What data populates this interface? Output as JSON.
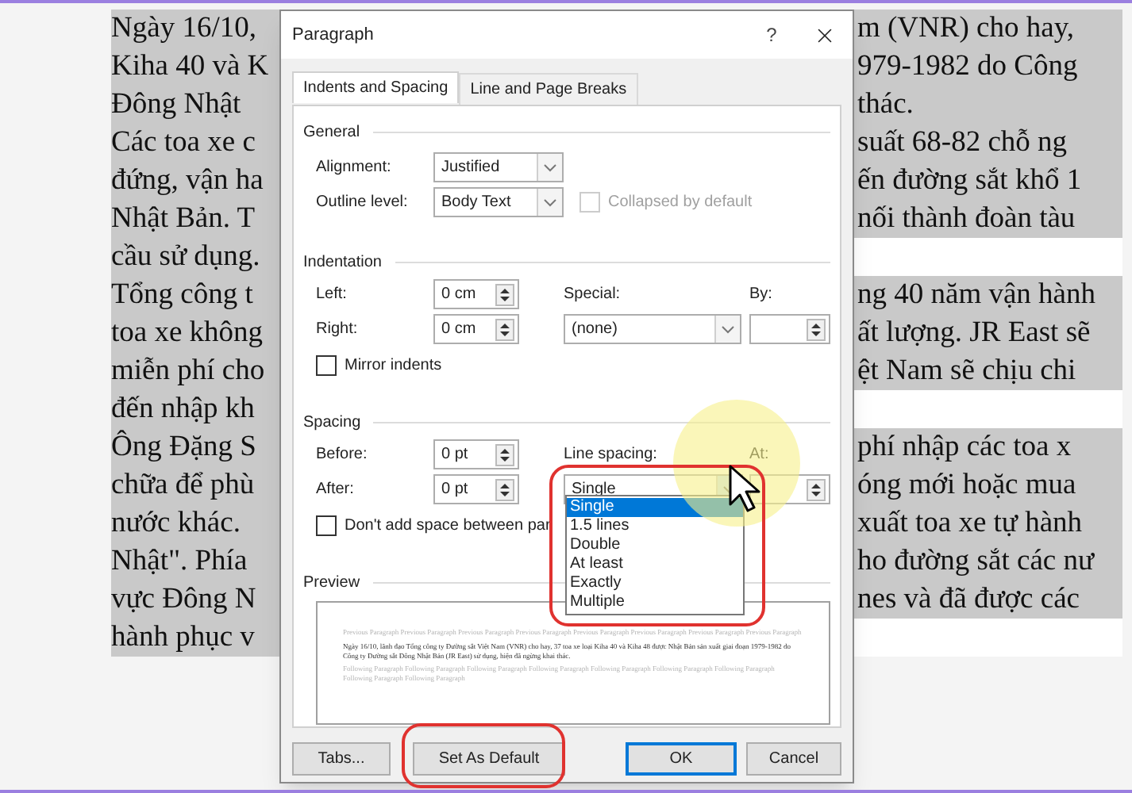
{
  "document": {
    "lines": [
      {
        "left": "Ngày 16/10,",
        "right": "m (VNR) cho hay,"
      },
      {
        "left": "Kiha 40 và K",
        "right": "979-1982 do Công"
      },
      {
        "left": "Đông Nhật",
        "right": "thác."
      },
      {
        "left": "Các toa xe c",
        "right": "suất 68-82 chỗ ng"
      },
      {
        "left": "đứng, vận ha",
        "right": "ến đường sắt khổ 1"
      },
      {
        "left": "Nhật Bản. T",
        "right": "nối thành đoàn tàu"
      },
      {
        "left": "cầu sử dụng."
      },
      {
        "left": "Tổng công t",
        "right": "ng 40 năm vận hành"
      },
      {
        "left": "toa xe không",
        "right": "ất lượng. JR East sẽ"
      },
      {
        "left": "miễn phí cho",
        "right": "ệt Nam sẽ chịu chi"
      },
      {
        "left": "đến nhập kh"
      },
      {
        "left": "Ông Đặng S",
        "right": "phí nhập các toa x"
      },
      {
        "left": "chữa để phù",
        "right": "óng mới hoặc mua"
      },
      {
        "left": "nước khác.",
        "right": "xuất toa xe tự hành"
      },
      {
        "left": "Nhật\". Phía",
        "right": "ho đường sắt các nư"
      },
      {
        "left": "vực Đông N",
        "right": "nes và đã được các"
      },
      {
        "left": "hành phục v"
      }
    ]
  },
  "dialog": {
    "title": "Paragraph",
    "help": "?",
    "tabs": [
      {
        "label": "Indents and Spacing",
        "selected": true
      },
      {
        "label": "Line and Page Breaks",
        "selected": false
      }
    ],
    "general": {
      "heading": "General",
      "alignment": {
        "label": "Alignment:",
        "value": "Justified"
      },
      "outline_level": {
        "label": "Outline level:",
        "value": "Body Text"
      },
      "collapsed": {
        "label": "Collapsed by default",
        "checked": false,
        "disabled": true
      }
    },
    "indentation": {
      "heading": "Indentation",
      "left": {
        "label": "Left:",
        "value": "0 cm"
      },
      "right": {
        "label": "Right:",
        "value": "0 cm"
      },
      "special": {
        "label": "Special:",
        "value": "(none)"
      },
      "by": {
        "label": "By:"
      },
      "mirror": {
        "label": "Mirror indents",
        "checked": false,
        "disabled": false
      }
    },
    "spacing": {
      "heading": "Spacing",
      "before": {
        "label": "Before:",
        "value": "0 pt"
      },
      "after": {
        "label": "After:",
        "value": "0 pt"
      },
      "line_spacing": {
        "label": "Line spacing:",
        "value": "Single",
        "expanded": true,
        "options": [
          {
            "label": "Single",
            "selected": true
          },
          {
            "label": "1.5 lines",
            "selected": false
          },
          {
            "label": "Double",
            "selected": false
          },
          {
            "label": "At least",
            "selected": false
          },
          {
            "label": "Exactly",
            "selected": false
          },
          {
            "label": "Multiple",
            "selected": false
          }
        ]
      },
      "at": {
        "label": "At:"
      },
      "dont_add": {
        "label": "Don't add space between par",
        "checked": false,
        "disabled": false
      }
    },
    "preview": {
      "heading": "Preview",
      "previous": "Previous Paragraph Previous Paragraph Previous Paragraph Previous Paragraph Previous Paragraph Previous Paragraph Previous Paragraph Previous Paragraph",
      "sample": "Ngày 16/10, lãnh đạo Tổng công ty Đường sắt Việt Nam (VNR) cho hay, 37 toa xe loại Kiha 40 và Kiha 48 được Nhật Bản sản xuất giai đoạn 1979-1982 do Công ty Đường sắt Đông Nhật Bản (JR East) sử dụng, hiện đã ngừng khai thác.",
      "following": "Following Paragraph Following Paragraph Following Paragraph Following Paragraph Following Paragraph Following Paragraph Following Paragraph Following Paragraph Following Paragraph"
    },
    "buttons": [
      {
        "label": "Tabs...",
        "default": false
      },
      {
        "label": "Set As Default",
        "default": false
      },
      {
        "label": "OK",
        "default": true
      },
      {
        "label": "Cancel",
        "default": false
      }
    ]
  }
}
